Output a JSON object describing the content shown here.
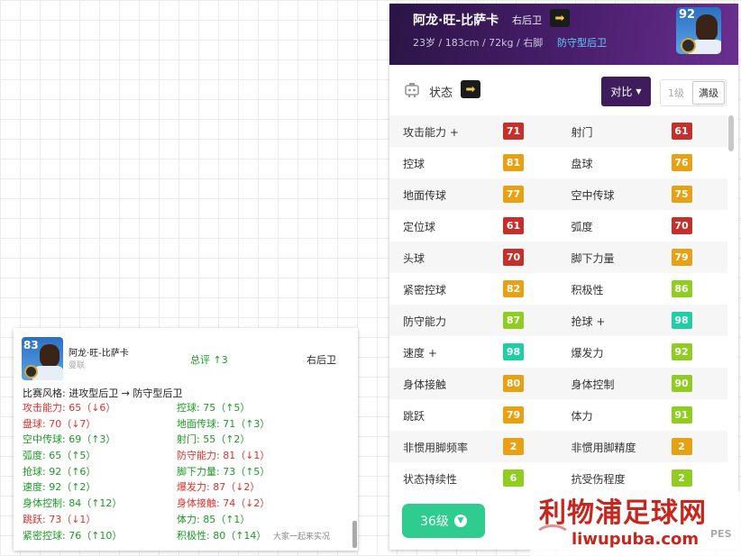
{
  "player": {
    "name": "阿龙·旺-比萨卡",
    "position": "右后卫",
    "info": "23岁 / 183cm / 72kg / 右脚",
    "playstyle": "防守型后卫",
    "overall": "92"
  },
  "status": {
    "label": "状态",
    "compare_label": "对比",
    "level_options": [
      "1级",
      "满级"
    ]
  },
  "stats": [
    {
      "left": {
        "label": "攻击能力 +",
        "value": "71",
        "color": "#c62f2a"
      },
      "right": {
        "label": "射门",
        "value": "61",
        "color": "#c62f2a"
      }
    },
    {
      "left": {
        "label": "控球",
        "value": "81",
        "color": "#e7a112"
      },
      "right": {
        "label": "盘球",
        "value": "76",
        "color": "#e7a112"
      }
    },
    {
      "left": {
        "label": "地面传球",
        "value": "77",
        "color": "#e7a112"
      },
      "right": {
        "label": "空中传球",
        "value": "75",
        "color": "#e7a112"
      }
    },
    {
      "left": {
        "label": "定位球",
        "value": "61",
        "color": "#c62f2a"
      },
      "right": {
        "label": "弧度",
        "value": "70",
        "color": "#c62f2a"
      }
    },
    {
      "left": {
        "label": "头球",
        "value": "70",
        "color": "#c62f2a"
      },
      "right": {
        "label": "脚下力量",
        "value": "79",
        "color": "#e7a112"
      }
    },
    {
      "left": {
        "label": "紧密控球",
        "value": "82",
        "color": "#e7a112"
      },
      "right": {
        "label": "积极性",
        "value": "86",
        "color": "#8fcd1f"
      }
    },
    {
      "left": {
        "label": "防守能力",
        "value": "87",
        "color": "#8fcd1f"
      },
      "right": {
        "label": "抢球 +",
        "value": "98",
        "color": "#1fcfa4"
      }
    },
    {
      "left": {
        "label": "速度 +",
        "value": "98",
        "color": "#1fcfa4"
      },
      "right": {
        "label": "爆发力",
        "value": "92",
        "color": "#8fcd1f"
      }
    },
    {
      "left": {
        "label": "身体接触",
        "value": "80",
        "color": "#e7a112"
      },
      "right": {
        "label": "身体控制",
        "value": "90",
        "color": "#8fcd1f"
      }
    },
    {
      "left": {
        "label": "跳跃",
        "value": "79",
        "color": "#e7a112"
      },
      "right": {
        "label": "体力",
        "value": "91",
        "color": "#8fcd1f"
      }
    },
    {
      "left": {
        "label": "非惯用脚频率",
        "value": "2",
        "color": "#e7a112"
      },
      "right": {
        "label": "非惯用脚精度",
        "value": "2",
        "color": "#e7a112"
      }
    },
    {
      "left": {
        "label": "状态持续性",
        "value": "6",
        "color": "#8fcd1f"
      },
      "right": {
        "label": "抗受伤程度",
        "value": "2",
        "color": "#8fcd1f"
      }
    }
  ],
  "level_button": "36级",
  "watermark": {
    "title": "利物浦足球网",
    "url": "liwupuba.com",
    "corner": "PES"
  },
  "compare_card": {
    "overall": "83",
    "name": "阿龙·旺-比萨卡",
    "sub": "曼联",
    "overall_change": "总评 ↑3",
    "position": "右后卫",
    "style_change": "比赛风格: 进攻型后卫 → 防守型后卫",
    "lines": [
      [
        {
          "text": "攻击能力: 65（↓6）",
          "dir": "down"
        },
        {
          "text": "控球: 75（↑5）",
          "dir": "up"
        }
      ],
      [
        {
          "text": "盘球: 70（↓7）",
          "dir": "down"
        },
        {
          "text": "地面传球: 71（↑3）",
          "dir": "up"
        }
      ],
      [
        {
          "text": "空中传球: 69（↑3）",
          "dir": "up"
        },
        {
          "text": "射门: 55（↑2）",
          "dir": "up"
        }
      ],
      [
        {
          "text": "弧度: 65（↑5）",
          "dir": "up"
        },
        {
          "text": "防守能力: 81（↓1）",
          "dir": "down"
        }
      ],
      [
        {
          "text": "抢球: 92（↑6）",
          "dir": "up"
        },
        {
          "text": "脚下力量: 73（↑5）",
          "dir": "up"
        }
      ],
      [
        {
          "text": "速度: 92（↑2）",
          "dir": "up"
        },
        {
          "text": "爆发力: 87（↓2）",
          "dir": "down"
        }
      ],
      [
        {
          "text": "身体控制: 84（↑12）",
          "dir": "up"
        },
        {
          "text": "身体接触: 74（↓2）",
          "dir": "down"
        }
      ],
      [
        {
          "text": "跳跃: 73（↓1）",
          "dir": "down"
        },
        {
          "text": "体力: 85（↑1）",
          "dir": "up"
        }
      ],
      [
        {
          "text": "紧密控球: 76（↑10）",
          "dir": "up"
        },
        {
          "text": "积极性: 80（↑14）",
          "dir": "up"
        }
      ]
    ],
    "logo_text": "大家一起来实况"
  }
}
